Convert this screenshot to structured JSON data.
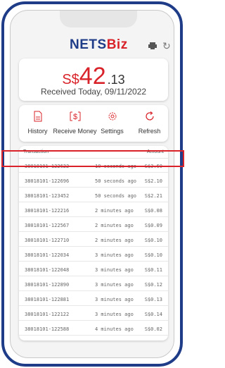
{
  "header": {
    "logo_nets": "NETS",
    "logo_biz": "Biz",
    "printer_icon": "printer-icon",
    "refresh_icon": "refresh-icon"
  },
  "summary": {
    "currency": "S$",
    "amount_int": "42",
    "amount_dec": ".13",
    "received_text": "Received Today, 09/11/2022"
  },
  "actions": [
    {
      "label": "History",
      "icon": "document-icon"
    },
    {
      "label": "Receive Money",
      "icon": "dollar-icon"
    },
    {
      "label": "Settings",
      "icon": "gear-icon"
    },
    {
      "label": "Refresh",
      "icon": "refresh-icon"
    }
  ],
  "transactions": {
    "col_transaction": "Transaction",
    "col_amount": "Amount",
    "rows": [
      {
        "id": "38018101-122622",
        "time": "10 seconds ago",
        "amount": "S$3.60"
      },
      {
        "id": "38018101-122696",
        "time": "50 seconds ago",
        "amount": "S$2.10"
      },
      {
        "id": "38018101-123452",
        "time": "50 seconds ago",
        "amount": "S$2.21"
      },
      {
        "id": "38018101-122216",
        "time": "2 minutes ago",
        "amount": "S$0.08"
      },
      {
        "id": "38018101-122567",
        "time": "2 minutes ago",
        "amount": "S$0.09"
      },
      {
        "id": "38018101-122710",
        "time": "2 minutes ago",
        "amount": "S$0.10"
      },
      {
        "id": "38018101-122034",
        "time": "3 minutes ago",
        "amount": "S$0.10"
      },
      {
        "id": "38018101-122048",
        "time": "3 minutes ago",
        "amount": "S$0.11"
      },
      {
        "id": "38018101-122890",
        "time": "3 minutes ago",
        "amount": "S$0.12"
      },
      {
        "id": "38018101-122881",
        "time": "3 minutes ago",
        "amount": "S$0.13"
      },
      {
        "id": "38018101-122122",
        "time": "3 minutes ago",
        "amount": "S$0.14"
      },
      {
        "id": "38018101-122588",
        "time": "4 minutes ago",
        "amount": "S$0.02"
      }
    ]
  },
  "colors": {
    "brand_blue": "#1f3c88",
    "brand_red": "#d9232a",
    "highlight": "#d9232a"
  }
}
